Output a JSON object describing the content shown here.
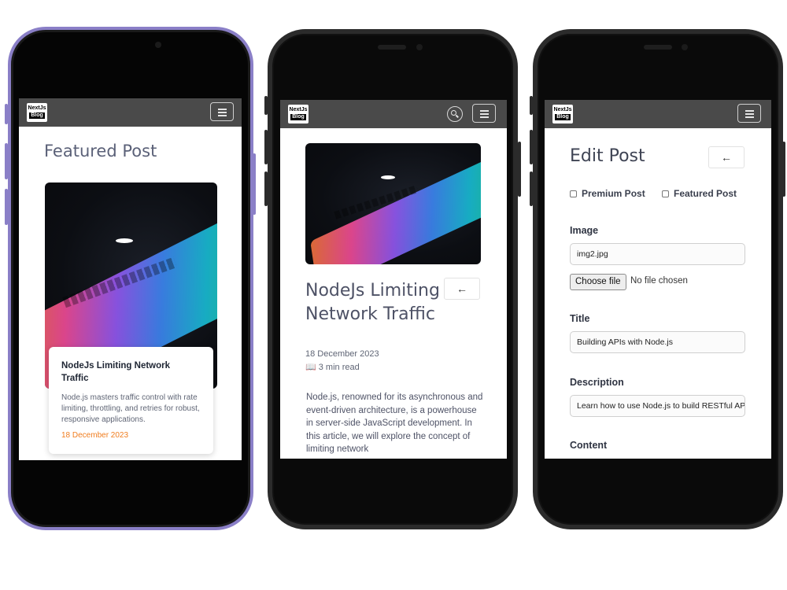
{
  "brand": {
    "logo_line1": "NextJs",
    "logo_line2": "Blog"
  },
  "screen1": {
    "heading": "Featured Post",
    "card": {
      "title": "NodeJs Limiting Network Traffic",
      "description": "Node.js masters traffic control with rate limiting, throttling, and retries for robust, responsive applications.",
      "date": "18 December 2023"
    }
  },
  "screen2": {
    "back_label": "←",
    "title": "NodeJs Limiting Network Traffic",
    "date": "18 December 2023",
    "read_time": "📖 3 min read",
    "body": "Node.js, renowned for its asynchronous and event-driven architecture, is a powerhouse in server-side JavaScript development. In this article, we will explore the concept of limiting network"
  },
  "screen3": {
    "heading": "Edit Post",
    "back_label": "←",
    "premium_label": "Premium Post",
    "featured_label": "Featured Post",
    "image_label": "Image",
    "image_value": "img2.jpg",
    "choose_file_label": "Choose file",
    "file_status": "No file chosen",
    "title_label": "Title",
    "title_value": "Building APIs with Node.js",
    "description_label": "Description",
    "description_value": "Learn how to use Node.js to build RESTful API",
    "content_label": "Content"
  },
  "colors": {
    "navbar": "#4a4a4a",
    "accent_date": "#f07d1f",
    "phone1_frame": "#8a7fc7",
    "phone_frame": "#2b2b2b"
  },
  "icons": [
    "hamburger-icon",
    "search-icon",
    "arrow-left-icon",
    "book-icon"
  ]
}
